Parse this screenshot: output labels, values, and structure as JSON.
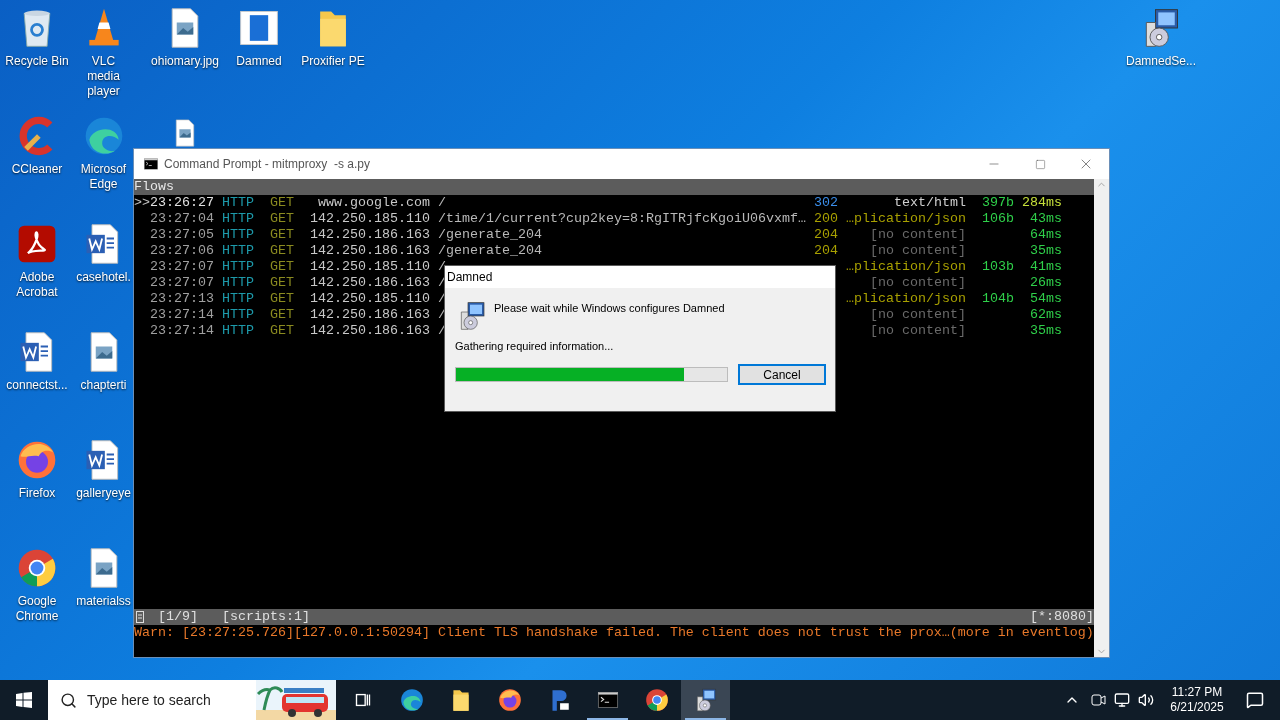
{
  "desktop_columns": [
    [
      {
        "label": "Recycle Bin",
        "kind": "recycle-bin"
      },
      {
        "label": "CCleaner",
        "kind": "ccleaner"
      },
      {
        "label": "Adobe Acrobat",
        "kind": "pdf"
      },
      {
        "label": "connectst...",
        "kind": "word"
      },
      {
        "label": "Firefox",
        "kind": "firefox"
      },
      {
        "label": "Google Chrome",
        "kind": "chrome"
      }
    ],
    [
      {
        "label": "VLC media player",
        "kind": "cone"
      },
      {
        "label": "Microsof Edge",
        "kind": "edge"
      },
      {
        "label": "casehotel.",
        "kind": "word"
      },
      {
        "label": "chapterti",
        "kind": "image-file"
      },
      {
        "label": "galleryeye",
        "kind": "word"
      },
      {
        "label": "materialss",
        "kind": "image-file"
      }
    ],
    [
      {
        "label": "ohiomary.jpg",
        "kind": "image-file"
      },
      {
        "kind": "image-file"
      }
    ],
    [
      {
        "label": "Damned",
        "kind": "app-window"
      }
    ],
    [
      {
        "label": "Proxifier PE",
        "kind": "folder"
      }
    ]
  ],
  "corner_icon": {
    "label": "DamnedSe...",
    "kind": "installer"
  },
  "terminal": {
    "title": "Command Prompt - mitmproxy  -s a.py",
    "header": "Flows",
    "cursor": ">>",
    "rows": [
      {
        "selected": true,
        "time": "23:26:27",
        "scheme": "HTTP",
        "method": "GET",
        "host": "www.google.com",
        "path": "/",
        "status": {
          "text": "302",
          "kind": "redirect"
        },
        "content_type": {
          "text": "text/html",
          "kind": "text"
        },
        "size": "397b",
        "duration": "284ms"
      },
      {
        "selected": false,
        "time": "23:27:04",
        "scheme": "HTTP",
        "method": "GET",
        "host": "142.250.185.110",
        "path": "/time/1/current?cup2key=8:RgITRjfcKgoiU06vxmf…",
        "status": {
          "text": "200",
          "kind": "ok"
        },
        "content_type": {
          "text": "…plication/json",
          "kind": "json"
        },
        "size": "106b",
        "duration": "43ms"
      },
      {
        "selected": false,
        "time": "23:27:05",
        "scheme": "HTTP",
        "method": "GET",
        "host": "142.250.186.163",
        "path": "/generate_204",
        "status": {
          "text": "204",
          "kind": "ok"
        },
        "content_type": {
          "text": "[no content]",
          "kind": "empty"
        },
        "duration": "64ms"
      },
      {
        "selected": false,
        "time": "23:27:06",
        "scheme": "HTTP",
        "method": "GET",
        "host": "142.250.186.163",
        "path": "/generate_204",
        "status": {
          "text": "204",
          "kind": "ok"
        },
        "content_type": {
          "text": "[no content]",
          "kind": "empty"
        },
        "duration": "35ms"
      },
      {
        "selected": false,
        "time": "23:27:07",
        "scheme": "HTTP",
        "method": "GET",
        "host": "142.250.185.110",
        "path": "/",
        "content_type": {
          "text": "…plication/json",
          "kind": "json"
        },
        "size": "103b",
        "duration": "41ms"
      },
      {
        "selected": false,
        "time": "23:27:07",
        "scheme": "HTTP",
        "method": "GET",
        "host": "142.250.186.163",
        "path": "/",
        "content_type": {
          "text": "[no content]",
          "kind": "empty"
        },
        "duration": "26ms"
      },
      {
        "selected": false,
        "time": "23:27:13",
        "scheme": "HTTP",
        "method": "GET",
        "host": "142.250.185.110",
        "path": "/",
        "content_type": {
          "text": "…plication/json",
          "kind": "json"
        },
        "size": "104b",
        "duration": "54ms"
      },
      {
        "selected": false,
        "time": "23:27:14",
        "scheme": "HTTP",
        "method": "GET",
        "host": "142.250.186.163",
        "path": "/",
        "content_type": {
          "text": "[no content]",
          "kind": "empty"
        },
        "duration": "62ms"
      },
      {
        "selected": false,
        "time": "23:27:14",
        "scheme": "HTTP",
        "method": "GET",
        "host": "142.250.186.163",
        "path": "/",
        "content_type": {
          "text": "[no content]",
          "kind": "empty"
        },
        "duration": "35ms"
      }
    ],
    "status_bar": {
      "position": "[1/9]",
      "scripts": "[scripts:1]",
      "listen": "[*:8080]"
    },
    "warning": "Warn: [23:27:25.726][127.0.0.1:50294] Client TLS handshake failed. The client does not trust the prox…(more in eventlog)"
  },
  "dialog": {
    "title": "Damned",
    "message": "Please wait while Windows configures Damned",
    "status": "Gathering required information...",
    "progress": {
      "level": 0.84
    },
    "button": "Cancel"
  },
  "taskbar": {
    "search_placeholder": "Type here to search",
    "apps": [
      {
        "kind": "task-view",
        "active": false,
        "running": false
      },
      {
        "kind": "edge",
        "active": false,
        "running": false
      },
      {
        "kind": "folder",
        "active": false,
        "running": false
      },
      {
        "kind": "firefox",
        "active": false,
        "running": false
      },
      {
        "kind": "proxifier",
        "active": false,
        "running": false
      },
      {
        "kind": "terminal",
        "active": false,
        "running": true
      },
      {
        "kind": "chrome",
        "active": false,
        "running": false
      },
      {
        "kind": "installer",
        "active": true,
        "running": true
      }
    ],
    "time": "11:27 PM",
    "date": "6/21/2025"
  }
}
